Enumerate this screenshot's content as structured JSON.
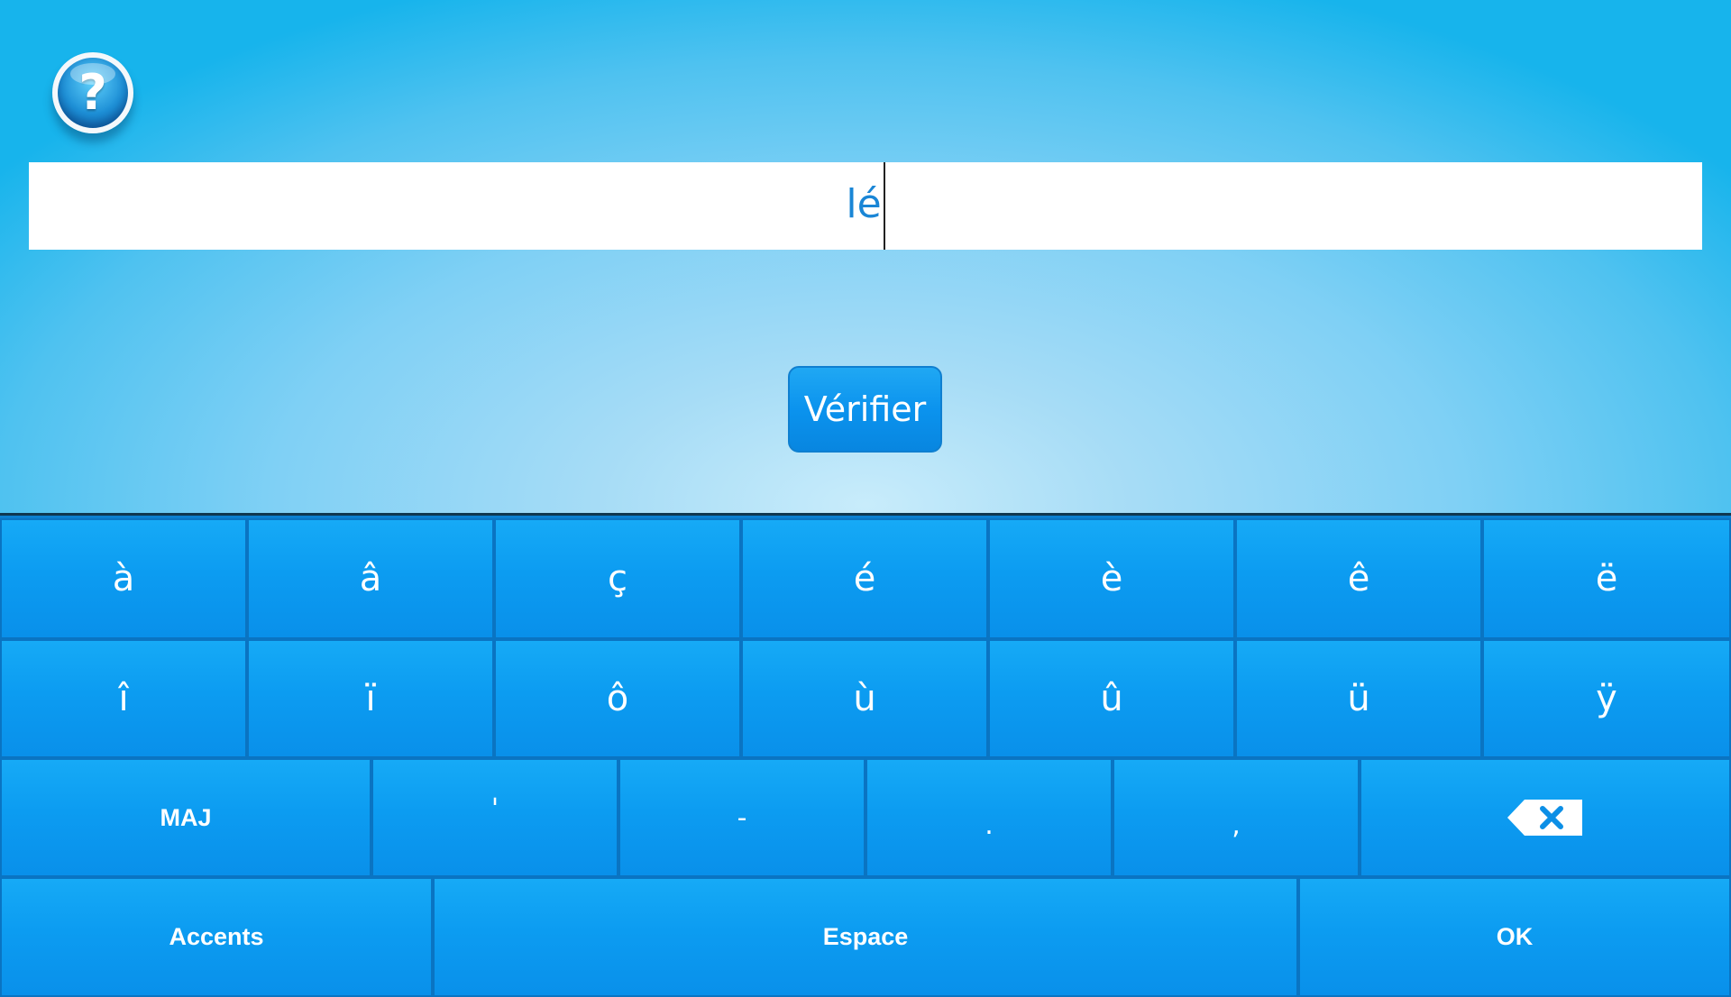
{
  "help": {
    "glyph": "?"
  },
  "answer": {
    "value": "lé"
  },
  "verify": {
    "label": "Vérifier"
  },
  "keyboard": {
    "row1": [
      "à",
      "â",
      "ç",
      "é",
      "è",
      "ê",
      "ë"
    ],
    "row2": [
      "î",
      "ï",
      "ô",
      "ù",
      "û",
      "ü",
      "ÿ"
    ],
    "row3": {
      "shift": "MAJ",
      "apostrophe": "'",
      "hyphen": "-",
      "period": ".",
      "comma": ",",
      "backspace_icon": "backspace-icon"
    },
    "row4": {
      "accents": "Accents",
      "space": "Espace",
      "ok": "OK"
    }
  },
  "colors": {
    "key_blue": "#0c9cf1",
    "key_border": "#0a74c2",
    "text_blue": "#1a86d6"
  }
}
